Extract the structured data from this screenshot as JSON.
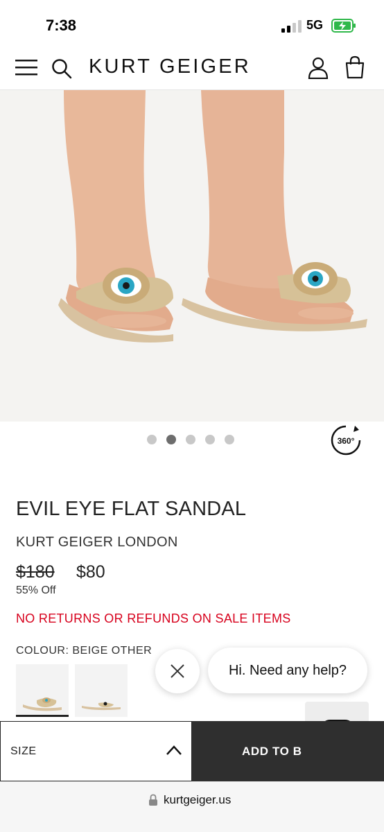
{
  "status_bar": {
    "time": "7:38",
    "network": "5G"
  },
  "header": {
    "logo": "KURT GEIGER",
    "menu_icon": "hamburger-menu-icon",
    "search_icon": "search-icon",
    "account_icon": "account-icon",
    "bag_icon": "shopping-bag-icon"
  },
  "gallery": {
    "image_count": 5,
    "active_index": 1,
    "spin_label": "360°"
  },
  "product": {
    "title": "EVIL EYE FLAT SANDAL",
    "brand": "KURT GEIGER LONDON",
    "price_original": "$180",
    "price_sale": "$80",
    "discount": "55% Off",
    "notice": "NO RETURNS OR REFUNDS ON SALE ITEMS",
    "colour_label": "COLOUR: BEIGE OTHER"
  },
  "chat": {
    "greeting": "Hi. Need any help?"
  },
  "actions": {
    "size_label": "SIZE",
    "add_label": "ADD TO B"
  },
  "browser": {
    "url": "kurtgeiger.us"
  },
  "colors": {
    "notice_red": "#d7001c",
    "add_button_bg": "#2f2f2f",
    "dot_active": "#6d6d6d",
    "dot_inactive": "#c8c8c8"
  }
}
